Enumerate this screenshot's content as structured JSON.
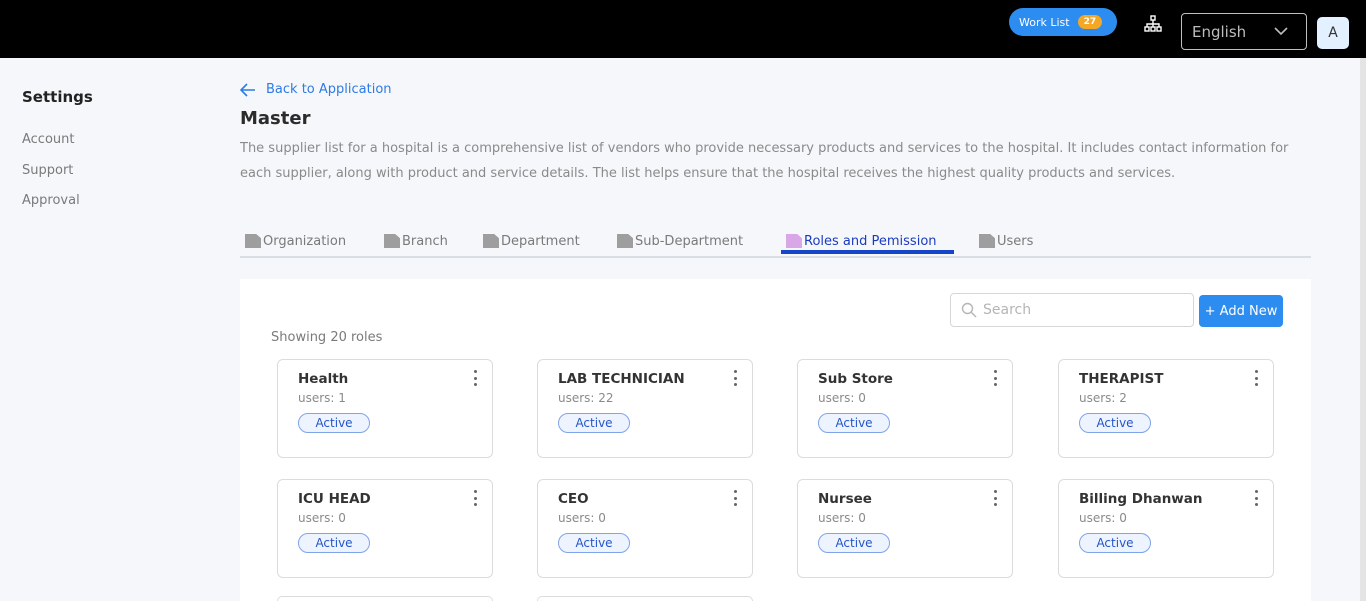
{
  "header": {
    "worklist_label": "Work List",
    "worklist_count": "27",
    "language": "English",
    "avatar_initial": "A"
  },
  "sidebar": {
    "title": "Settings",
    "items": [
      "Account",
      "Support",
      "Approval"
    ]
  },
  "main": {
    "back_label": "Back to Application",
    "title": "Master",
    "description": "The supplier list for a hospital is a comprehensive list of vendors who provide necessary products and services to the hospital. It includes contact information for each supplier, along with product and service details. The list helps ensure that the hospital receives the highest quality products and services.",
    "tabs": [
      "Organization",
      "Branch",
      "Department",
      "Sub-Department",
      "Roles and Pemission",
      "Users"
    ],
    "active_tab": "Roles and Pemission",
    "search_placeholder": "Search",
    "add_new_label": "+ Add New",
    "showing_text": "Showing 20 roles",
    "roles": [
      {
        "name": "Health",
        "users": "users: 1",
        "status": "Active"
      },
      {
        "name": "LAB TECHNICIAN",
        "users": "users: 22",
        "status": "Active"
      },
      {
        "name": "Sub Store",
        "users": "users: 0",
        "status": "Active"
      },
      {
        "name": "THERAPIST",
        "users": "users: 2",
        "status": "Active"
      },
      {
        "name": "ICU HEAD",
        "users": "users: 0",
        "status": "Active"
      },
      {
        "name": "CEO",
        "users": "users: 0",
        "status": "Active"
      },
      {
        "name": "Nursee",
        "users": "users: 0",
        "status": "Active"
      },
      {
        "name": "Billing Dhanwan",
        "users": "users: 0",
        "status": "Active"
      }
    ]
  },
  "colors": {
    "accent": "#2d8cf0",
    "active_tab": "#1546c9",
    "badge": "#f5a623"
  }
}
